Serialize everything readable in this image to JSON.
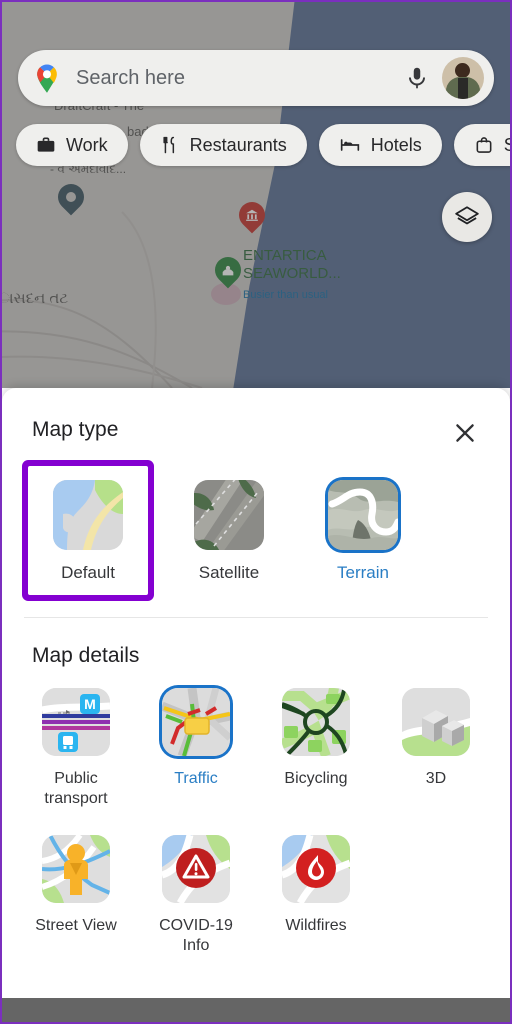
{
  "app": {
    "name": "Google Maps",
    "bottom_bar_color": "#656565",
    "highlight_color": "#8400d1",
    "accent_color": "#1a73c8"
  },
  "search": {
    "placeholder": "Search here",
    "maps_pin_icon": "google-maps-pin-icon",
    "mic_icon": "microphone-icon",
    "avatar_icon": "account-avatar"
  },
  "chips": [
    {
      "label": "Work",
      "icon": "briefcase-icon"
    },
    {
      "label": "Restaurants",
      "icon": "fork-knife-icon"
    },
    {
      "label": "Hotels",
      "icon": "bed-icon"
    },
    {
      "label": "Shopping",
      "icon": "shopping-bag-icon"
    }
  ],
  "map": {
    "layers_button_icon": "layers-icon",
    "labels": [
      {
        "text": "DraftCraft - The",
        "kind": "place"
      },
      {
        "text": "…bad",
        "kind": "place"
      },
      {
        "text": "- વ અમદાવાદ...",
        "kind": "place"
      },
      {
        "text": "ાસદન તટ",
        "kind": "place"
      }
    ],
    "poi": {
      "name_line1": "ENTARTICA",
      "name_line2": "SEAWORLD...",
      "status": "Busier than usual"
    },
    "pins": [
      {
        "name": "dark-teal-pin",
        "color": "#3d5661"
      },
      {
        "name": "red-museum-pin",
        "color": "#c5352e"
      },
      {
        "name": "green-park-pin",
        "color": "#2e8540"
      }
    ]
  },
  "sheet": {
    "map_type": {
      "title": "Map type",
      "close_label": "Close",
      "close_icon": "close-icon",
      "options": [
        {
          "label": "Default",
          "icon": "map-default-thumbnail",
          "selected": false,
          "highlighted": true
        },
        {
          "label": "Satellite",
          "icon": "map-satellite-thumbnail",
          "selected": false,
          "highlighted": false
        },
        {
          "label": "Terrain",
          "icon": "map-terrain-thumbnail",
          "selected": true,
          "highlighted": false
        }
      ]
    },
    "map_details": {
      "title": "Map details",
      "rows": [
        [
          {
            "label": "Public transport",
            "icon": "public-transport-thumbnail",
            "selected": false
          },
          {
            "label": "Traffic",
            "icon": "traffic-thumbnail",
            "selected": true
          },
          {
            "label": "Bicycling",
            "icon": "bicycling-thumbnail",
            "selected": false
          },
          {
            "label": "3D",
            "icon": "three-d-thumbnail",
            "selected": false
          }
        ],
        [
          {
            "label": "Street View",
            "icon": "street-view-thumbnail",
            "selected": false
          },
          {
            "label": "COVID-19 Info",
            "icon": "covid-19-info-thumbnail",
            "selected": false
          },
          {
            "label": "Wildfires",
            "icon": "wildfires-thumbnail",
            "selected": false
          }
        ]
      ]
    }
  }
}
